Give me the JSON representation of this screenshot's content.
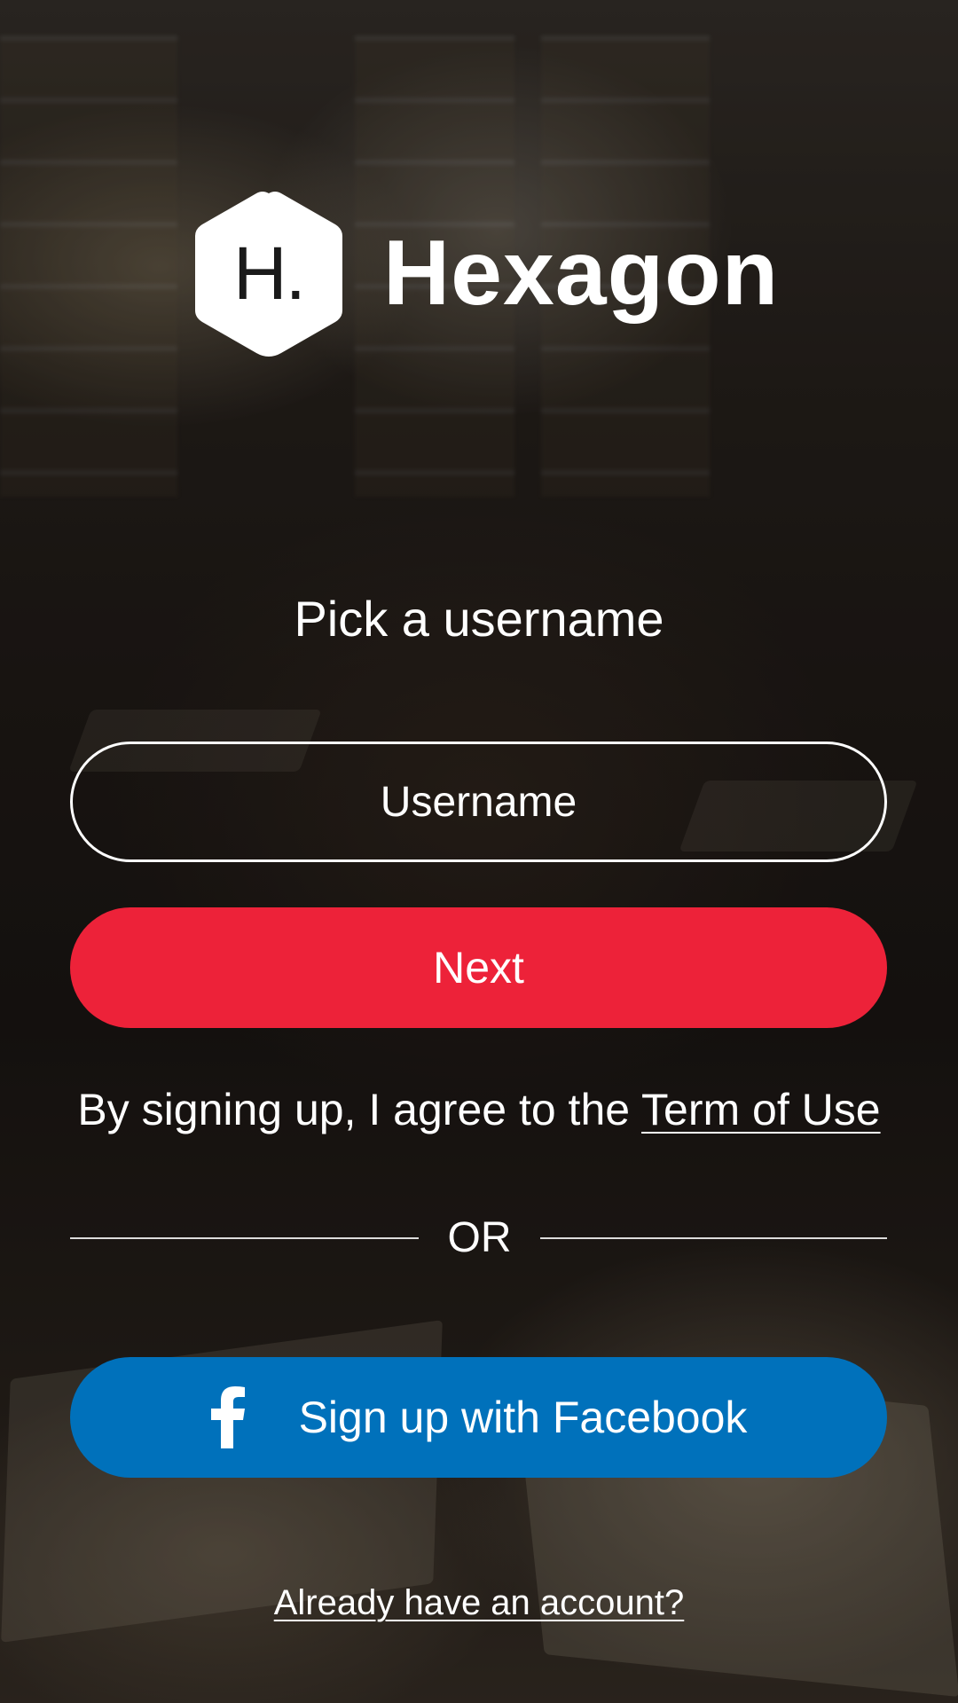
{
  "app": {
    "brand_name": "Hexagon",
    "logo_letter": "H."
  },
  "signup": {
    "heading": "Pick a username",
    "username_placeholder": "Username",
    "username_value": "",
    "next_label": "Next",
    "terms_prefix": "By signing up, I agree to the ",
    "terms_link": "Term of Use",
    "or_label": "OR",
    "facebook_label": "Sign up with Facebook",
    "login_link": "Already have an account?"
  },
  "icons": {
    "logo": "hexagon-logo-icon",
    "facebook": "facebook-icon"
  },
  "colors": {
    "next_button": "#ed2239",
    "facebook_button": "#0071bb",
    "text": "#ffffff"
  }
}
